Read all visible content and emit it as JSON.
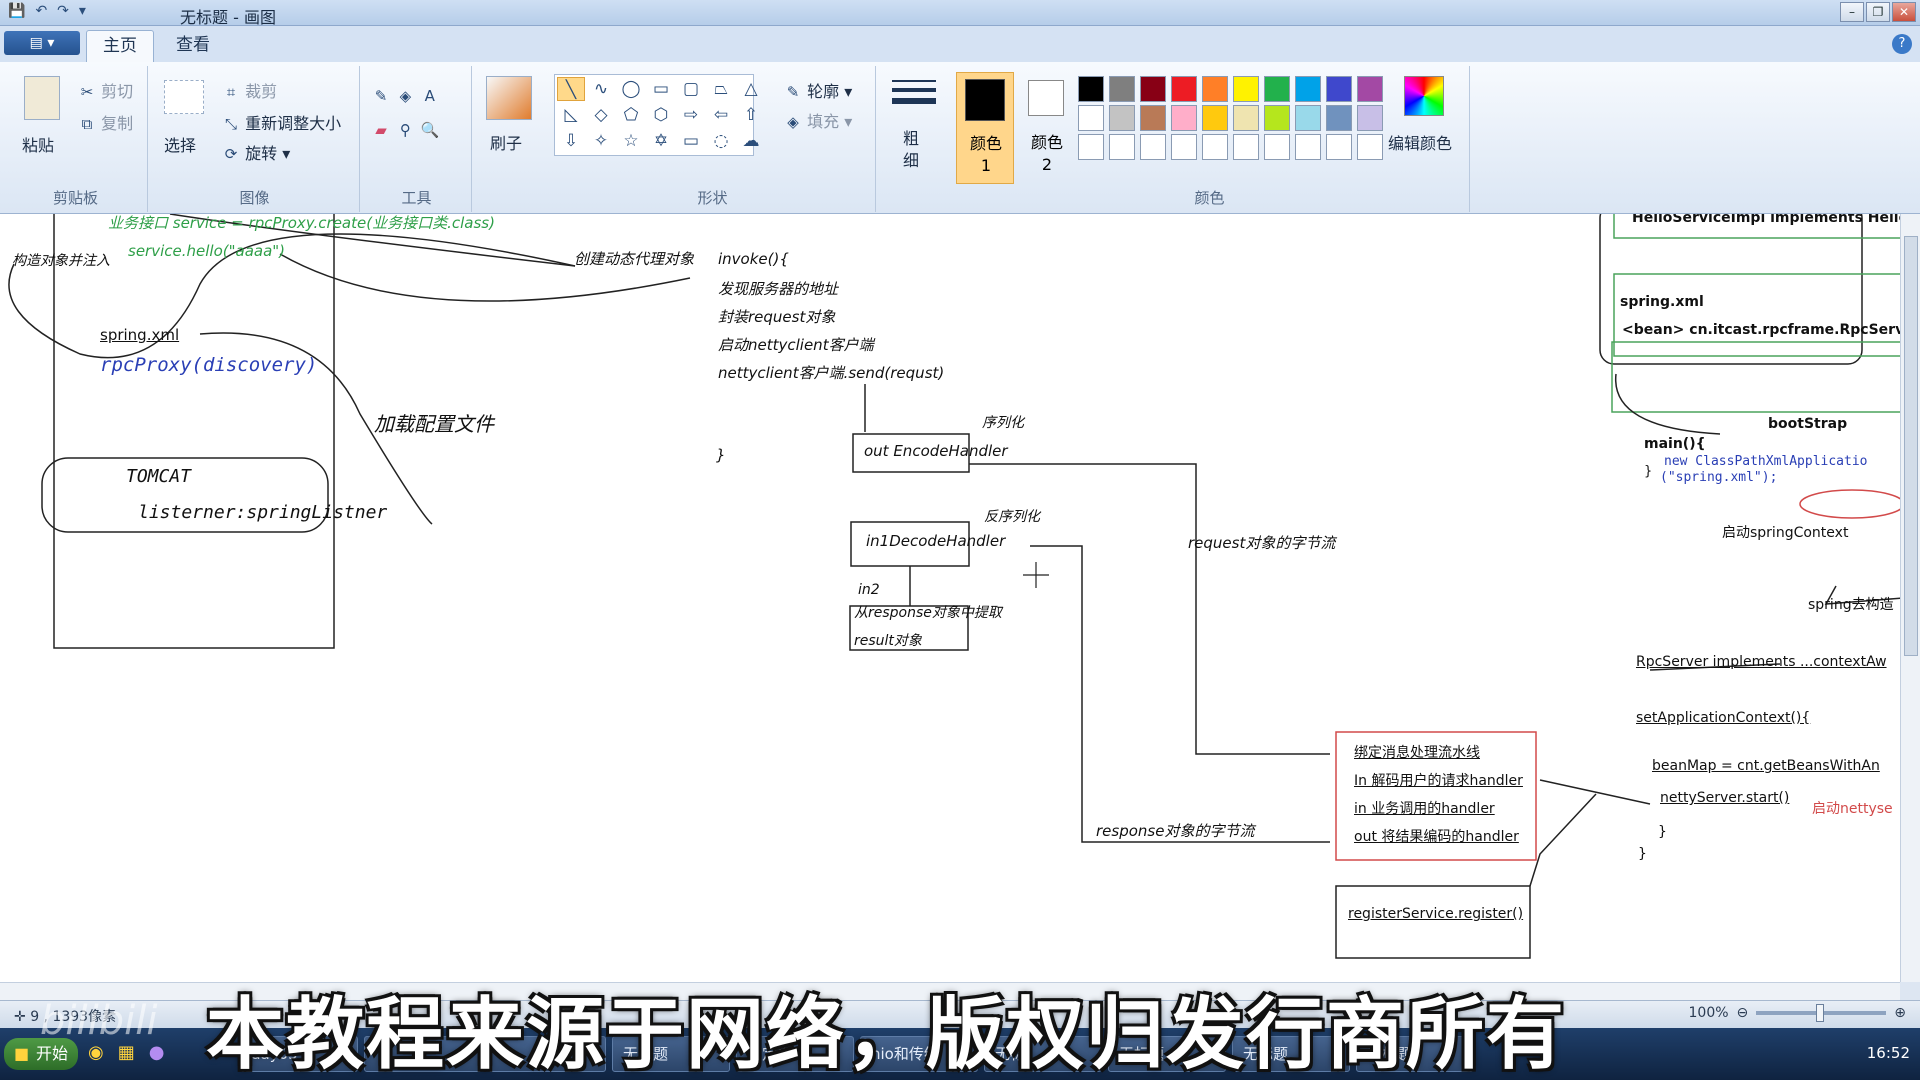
{
  "window": {
    "title": "无标题 - 画图",
    "quick_access": [
      "💾",
      "↶",
      "↷",
      "▾"
    ]
  },
  "tabs": [
    {
      "label": "主页",
      "active": true
    },
    {
      "label": "查看",
      "active": false
    }
  ],
  "ribbon": {
    "clipboard": {
      "paste": "粘贴",
      "cut": "剪切",
      "copy": "复制",
      "group": "剪贴板"
    },
    "image": {
      "select": "选择",
      "crop": "裁剪",
      "resize": "重新调整大小",
      "rotate": "旋转",
      "group": "图像"
    },
    "tools": {
      "group": "工具"
    },
    "brush": {
      "label": "刷子"
    },
    "shapes": {
      "outline": "轮廓",
      "fill": "填充",
      "group": "形状"
    },
    "size": {
      "label": "粗细"
    },
    "colors": {
      "color1": "颜色 1",
      "color2": "颜色 2",
      "edit": "编辑颜色",
      "group": "颜色",
      "palette": [
        "#000000",
        "#7f7f7f",
        "#880015",
        "#ed1c24",
        "#ff7f27",
        "#fff200",
        "#22b14c",
        "#00a2e8",
        "#3f48cc",
        "#a349a4",
        "#ffffff",
        "#c3c3c3",
        "#b97a57",
        "#ffaec9",
        "#ffc90e",
        "#efe4b0",
        "#b5e61d",
        "#99d9ea",
        "#7092be",
        "#c8bfe7",
        "#ffffff",
        "#ffffff",
        "#ffffff",
        "#ffffff",
        "#ffffff",
        "#ffffff",
        "#ffffff",
        "#ffffff",
        "#ffffff",
        "#ffffff"
      ]
    }
  },
  "canvas": {
    "texts": {
      "iface_create": "业务接口 service = rpcProxy.create(业务接口类.class)",
      "hello_call": "service.hello(\"aaaa\")",
      "construct_inject": "构造对象并注入",
      "create_proxy": "创建动态代理对象",
      "spring_xml_left": "spring.xml",
      "rpc_proxy": "rpcProxy(discovery)",
      "load_config": "加载配置文件",
      "tomcat": "TOMCAT",
      "listener": "listerner:springListner",
      "invoke": "invoke(){",
      "find_addr": "发现服务器的地址",
      "wrap_request": "封装request对象",
      "start_client": "启动nettyclient客户端",
      "client_send": "nettyclient客户端.send(requst)",
      "close_brace": "}",
      "serialize": "序列化",
      "out_encode": "out  EncodeHandler",
      "deserialize": "反序列化",
      "in1_decode": "in1DecodeHandler",
      "in2": "in2",
      "extract_result": "从response对象中提取",
      "result_obj": "result对象",
      "request_bytes": "request对象的字节流",
      "response_bytes": "response对象的字节流",
      "pipeline_bind": "绑定消息处理流水线",
      "pipeline_in_decode": "In 解码用户的请求handler",
      "pipeline_in_biz": "in 业务调用的handler",
      "pipeline_out_encode": "out 将结果编码的handler",
      "register": "registerService.register()",
      "impl_header": "HelloServiceImpl  implements Hello",
      "spring_xml_right": "spring.xml",
      "bean_decl": "<bean> cn.itcast.rpcframe.RpcServe",
      "bootstrap": "bootStrap",
      "main": "main(){",
      "new_ctx": "new ClassPathXmlApplicatio",
      "spring_xml_arg": "(\"spring.xml\");",
      "brace_small": "}",
      "start_context": "启动springContext",
      "spring_build": "spring去构造",
      "rpcserver_impl": "RpcServer implements ...contextAw",
      "set_app_ctx": "setApplicationContext(){",
      "bean_map": "beanMap = cnt.getBeansWithAn",
      "netty_start": "nettyServer.start()",
      "start_netty": "启动nettyse",
      "end_brace1": "}",
      "end_brace2": "}"
    }
  },
  "status": {
    "coords": "9 , 1393像素",
    "zoom": "100%"
  },
  "taskbar": {
    "start": "开始",
    "tasks": [
      "day05",
      "",
      "",
      "无标题",
      "自定义",
      "nio和传统",
      "无标",
      "无标题",
      "无标题",
      "无标题"
    ],
    "time": "16:52"
  },
  "overlay": {
    "subtitle": "本教程来源于网络，版权归发行商所有",
    "watermark": "bilibili"
  }
}
